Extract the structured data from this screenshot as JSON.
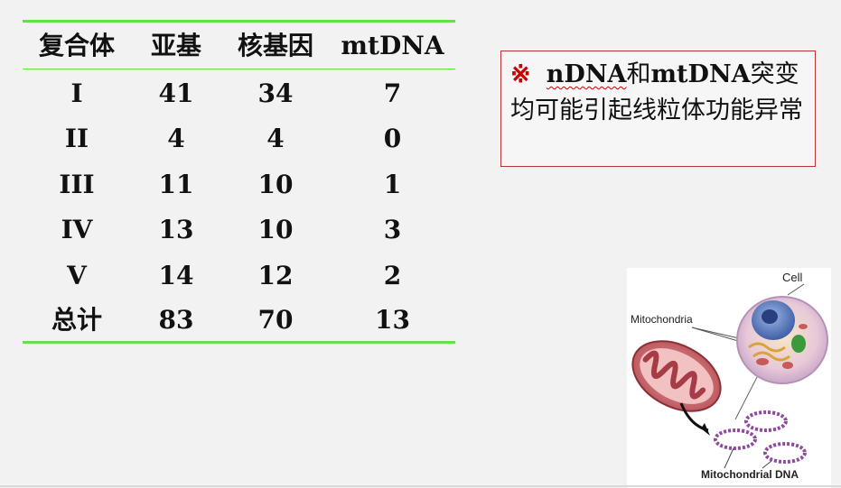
{
  "table": {
    "headers": [
      "复合体",
      "亚基",
      "核基因",
      "mtDNA"
    ],
    "rows": [
      [
        "I",
        "41",
        "34",
        "7"
      ],
      [
        "II",
        "4",
        "4",
        "0"
      ],
      [
        "III",
        "11",
        "10",
        "1"
      ],
      [
        "IV",
        "13",
        "10",
        "3"
      ],
      [
        "V",
        "14",
        "12",
        "2"
      ],
      [
        "总计",
        "83",
        "70",
        "13"
      ]
    ]
  },
  "note": {
    "mark": "※",
    "ndna": "nDNA",
    "he": "和",
    "mtdna": "mtDNA",
    "text_rest": "突变均可能引起线粒体功能异常"
  },
  "figure": {
    "label_cell": "Cell",
    "label_mitochondria": "Mitochondria",
    "label_dna": "Mitochondrial  DNA"
  },
  "colors": {
    "rule_green": "#66e04a",
    "note_border": "#b33333",
    "mark_red": "#cc0000"
  }
}
